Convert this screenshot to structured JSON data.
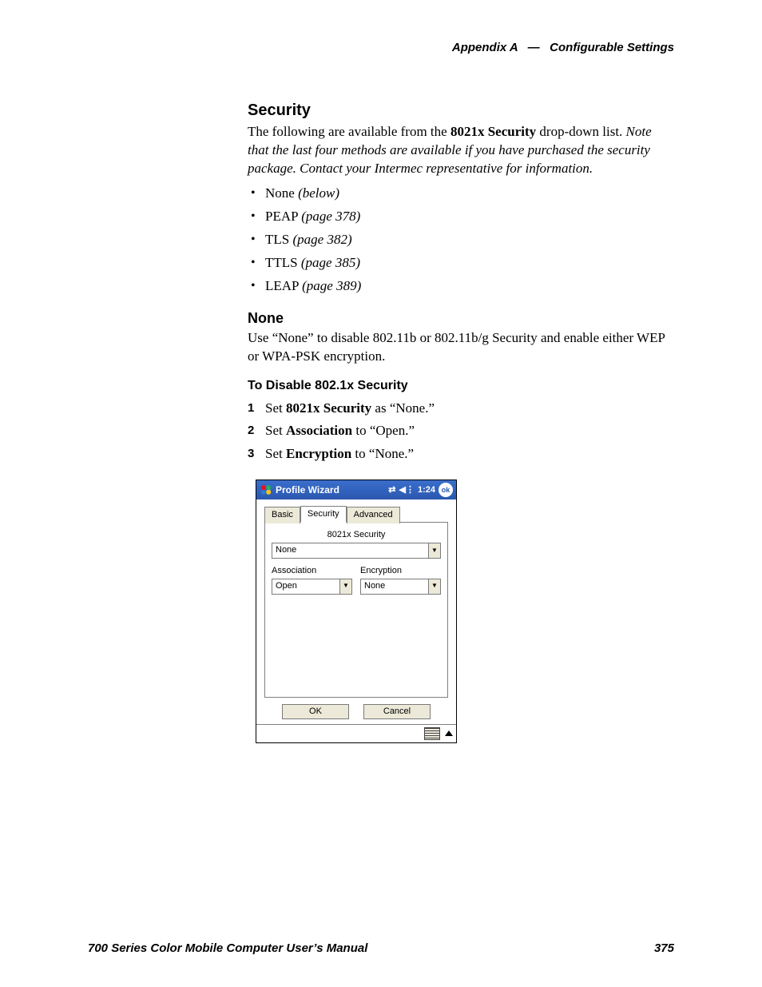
{
  "header": {
    "appendix": "Appendix A",
    "sep": "—",
    "title": "Configurable Settings"
  },
  "security": {
    "heading": "Security",
    "intro_pre": "The following are available from the ",
    "intro_bold": "8021x Security",
    "intro_mid": " drop-down list. ",
    "intro_ital": "Note that the last four methods are available if you have purchased the security package. Contact your Intermec representative for information.",
    "items": [
      {
        "name": "None",
        "ref": "(below)"
      },
      {
        "name": "PEAP",
        "ref": "(page 378)"
      },
      {
        "name": "TLS",
        "ref": "(page 382)"
      },
      {
        "name": "TTLS",
        "ref": "(page 385)"
      },
      {
        "name": "LEAP",
        "ref": "(page 389)"
      }
    ]
  },
  "none": {
    "heading": "None",
    "para": "Use “None” to disable 802.11b or 802.11b/g Security and enable either WEP or WPA-PSK encryption.",
    "task_heading": "To Disable 802.1x Security",
    "steps": [
      {
        "pre": "Set ",
        "bold": "8021x Security",
        "post": " as “None.”"
      },
      {
        "pre": "Set ",
        "bold": "Association",
        "post": " to “Open.”"
      },
      {
        "pre": "Set ",
        "bold": "Encryption",
        "post": " to “None.”"
      }
    ]
  },
  "shot": {
    "title": "Profile Wizard",
    "time": "1:24",
    "ok": "ok",
    "tabs": {
      "basic": "Basic",
      "security": "Security",
      "advanced": "Advanced"
    },
    "labels": {
      "x8021": "8021x Security",
      "association": "Association",
      "encryption": "Encryption"
    },
    "values": {
      "x8021": "None",
      "association": "Open",
      "encryption": "None"
    },
    "buttons": {
      "ok": "OK",
      "cancel": "Cancel"
    }
  },
  "footer": {
    "manual": "700 Series Color Mobile Computer User’s Manual",
    "page": "375"
  }
}
